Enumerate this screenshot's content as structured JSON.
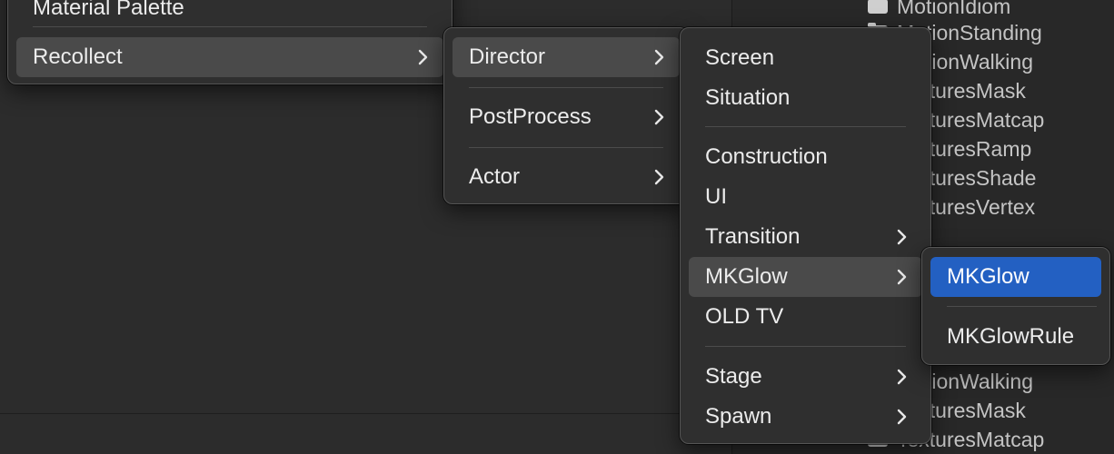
{
  "background": {
    "files_top": [
      "MotionIdiom",
      "MotionStanding",
      "MotionWalking",
      "TexturesMask",
      "TexturesMatcap",
      "TexturesRamp",
      "TexturesShade",
      "TexturesVertex"
    ],
    "files_bottom": [
      "MotionWalking",
      "TexturesMask",
      "TexturesMatcap"
    ]
  },
  "menu1": {
    "partial_item": "Material Palette",
    "recollect": "Recollect"
  },
  "menu2": {
    "items": [
      "Director",
      "PostProcess",
      "Actor"
    ]
  },
  "menu3": {
    "items": [
      "Screen",
      "Situation",
      "Construction",
      "UI",
      "Transition",
      "MKGlow",
      "OLD TV",
      "Stage",
      "Spawn"
    ]
  },
  "menu4": {
    "items": [
      "MKGlow",
      "MKGlowRule"
    ]
  },
  "colors": {
    "selection": "#2360c2",
    "hover": "#4a4a4a",
    "menu_bg": "#2f2f2f"
  }
}
